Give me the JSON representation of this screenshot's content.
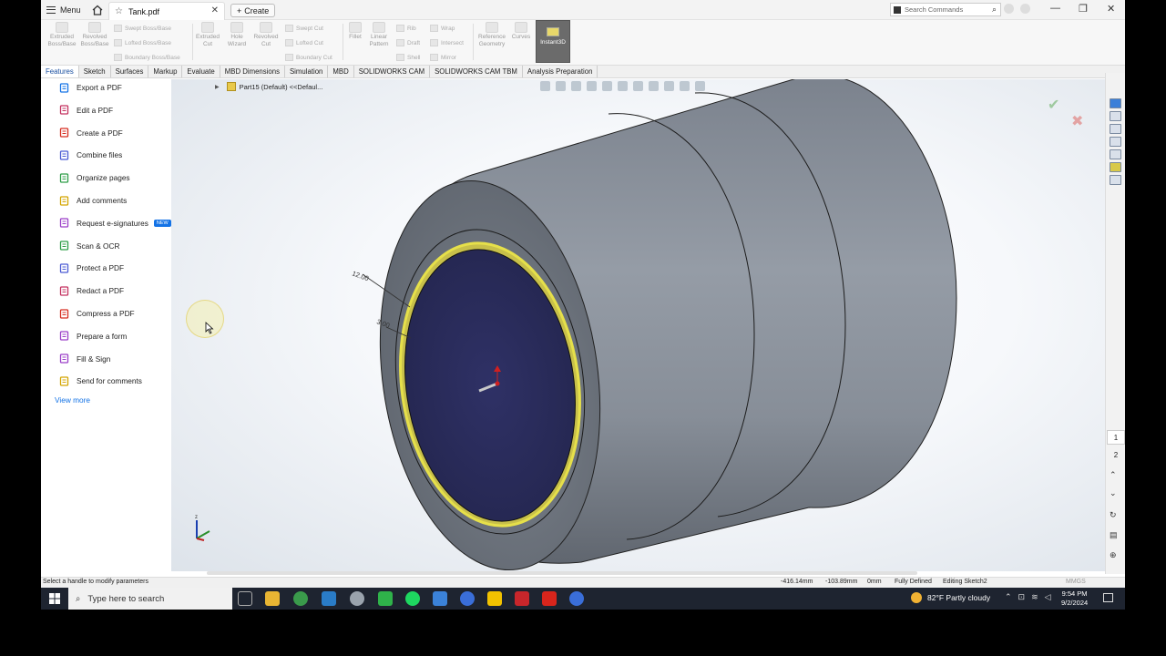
{
  "titlebar": {
    "menu_label": "Menu",
    "tab_title": "Tank.pdf",
    "create_label": "Create",
    "search_placeholder": "Search Commands"
  },
  "ribbon": {
    "extruded_boss": "Extruded Boss/Base",
    "revolved_boss": "Revolved Boss/Base",
    "swept_boss": "Swept Boss/Base",
    "lofted_boss": "Lofted Boss/Base",
    "boundary_boss": "Boundary Boss/Base",
    "extruded_cut": "Extruded Cut",
    "hole_wizard": "Hole Wizard",
    "revolved_cut": "Revolved Cut",
    "swept_cut": "Swept Cut",
    "lofted_cut": "Lofted Cut",
    "boundary_cut": "Boundary Cut",
    "fillet": "Fillet",
    "linear_pattern": "Linear Pattern",
    "rib": "Rib",
    "draft": "Draft",
    "shell": "Shell",
    "wrap": "Wrap",
    "intersect": "Intersect",
    "mirror": "Mirror",
    "reference_geometry": "Reference Geometry",
    "curves": "Curves",
    "instant3d": "Instant3D"
  },
  "cm_tabs": [
    "Features",
    "Sketch",
    "Surfaces",
    "Markup",
    "Evaluate",
    "MBD Dimensions",
    "Simulation",
    "MBD",
    "SOLIDWORKS CAM",
    "SOLIDWORKS CAM TBM",
    "Analysis Preparation"
  ],
  "left_panel": {
    "items": [
      {
        "label": "Export a PDF",
        "color": "#1473e6",
        "icon": "export-pdf-icon"
      },
      {
        "label": "Edit a PDF",
        "color": "#c4305f",
        "icon": "edit-pdf-icon"
      },
      {
        "label": "Create a PDF",
        "color": "#d62d20",
        "icon": "create-pdf-icon"
      },
      {
        "label": "Combine files",
        "color": "#4b5bd4",
        "icon": "combine-files-icon"
      },
      {
        "label": "Organize pages",
        "color": "#2d9e47",
        "icon": "organize-pages-icon"
      },
      {
        "label": "Add comments",
        "color": "#d4a500",
        "icon": "comment-icon"
      },
      {
        "label": "Request e-signatures",
        "color": "#9b3fc8",
        "icon": "esign-icon"
      },
      {
        "label": "Scan & OCR",
        "color": "#2d9e47",
        "icon": "scan-ocr-icon"
      },
      {
        "label": "Protect a PDF",
        "color": "#4b5bd4",
        "icon": "protect-pdf-icon"
      },
      {
        "label": "Redact a PDF",
        "color": "#c4305f",
        "icon": "redact-pdf-icon"
      },
      {
        "label": "Compress a PDF",
        "color": "#d62d20",
        "icon": "compress-pdf-icon"
      },
      {
        "label": "Prepare a form",
        "color": "#9b3fc8",
        "icon": "form-icon"
      },
      {
        "label": "Fill & Sign",
        "color": "#9b3fc8",
        "icon": "fill-sign-icon"
      },
      {
        "label": "Send for comments",
        "color": "#d4a500",
        "icon": "send-comments-icon"
      }
    ],
    "new_badge": "NEW",
    "view_more": "View more"
  },
  "viewport": {
    "tree_root": "Part15 (Default) <<Defaul...",
    "dim_outer": "12.00",
    "dim_inner": "3.00"
  },
  "task_pane": {
    "page_1": "1",
    "page_2": "2"
  },
  "statusbar": {
    "message": "Select a handle to modify parameters",
    "x": "-416.14mm",
    "y": "-103.89mm",
    "z": "0mm",
    "state": "Fully Defined",
    "editing": "Editing Sketch2",
    "units": "MMGS"
  },
  "taskbar": {
    "search_placeholder": "Type here to search",
    "weather": "82°F  Partly cloudy",
    "time": "9:54 PM",
    "date": "9/2/2024"
  },
  "colors": {
    "accent": "#1473e6",
    "body_gray": "#8e96a1",
    "face_navy": "#2b2d5c",
    "highlight_yellow": "#e6e04a"
  }
}
